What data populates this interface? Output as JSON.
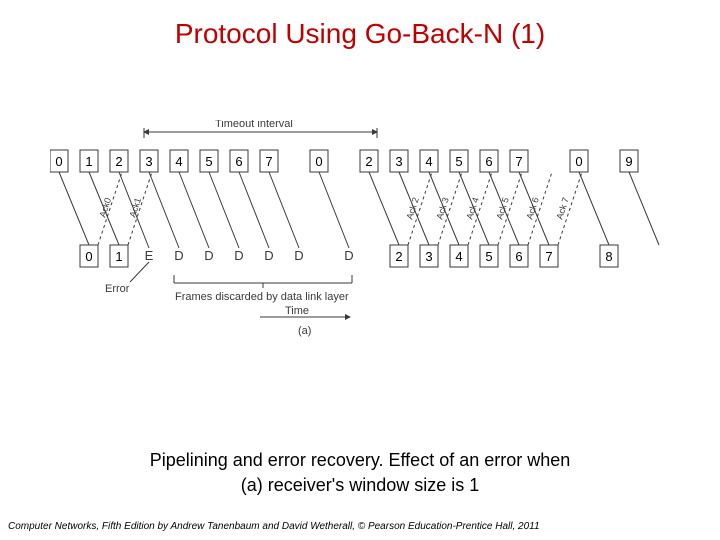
{
  "title": "Protocol Using Go-Back-N (1)",
  "caption_line1": "Pipelining and error recovery. Effect of an error when",
  "caption_line2": "(a) receiver's window size is 1",
  "footer_book": "Computer Networks",
  "footer_rest": ", Fifth Edition by Andrew Tanenbaum and David Wetherall, © Pearson Education-Prentice Hall, 2011",
  "timeout_label": "Timeout interval",
  "error_label": "Error",
  "discard_label": "Frames discarded by data link layer",
  "time_label": "Time",
  "subfig": "(a)",
  "sender_row1": [
    "0",
    "1",
    "2",
    "3",
    "4",
    "5",
    "6",
    "7"
  ],
  "sender_row2": [
    "0",
    "2",
    "3",
    "4",
    "5",
    "6",
    "7"
  ],
  "sender_row3": [
    "0",
    "9"
  ],
  "receiver_ok": [
    "0",
    "1"
  ],
  "receiver_err": [
    "E",
    "D",
    "D",
    "D",
    "D",
    "D",
    "D"
  ],
  "receiver_row2": [
    "2",
    "3",
    "4",
    "5",
    "6",
    "7",
    "8"
  ],
  "acks1": [
    "Ack0",
    "Ack1"
  ],
  "acks2": [
    "Ack 2",
    "Ack 3",
    "Ack 4",
    "Ack 5",
    "Ack 6",
    "Ack 7"
  ]
}
